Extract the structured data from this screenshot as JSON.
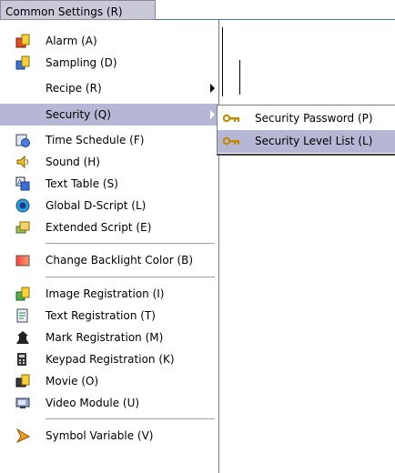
{
  "menubar": {
    "label": "Common Settings (R)"
  },
  "main_items": [
    {
      "label": "Alarm (A)",
      "icon": "alarm-icon"
    },
    {
      "label": "Sampling (D)",
      "icon": "sampling-icon"
    },
    {
      "label": "Recipe (R)",
      "icon": "",
      "submenu": true
    },
    {
      "label": "Security (Q)",
      "icon": "",
      "submenu": true,
      "selected": true
    },
    {
      "label": "Time Schedule (F)",
      "icon": "time-schedule-icon"
    },
    {
      "label": "Sound (H)",
      "icon": "sound-icon"
    },
    {
      "label": "Text Table (S)",
      "icon": "text-table-icon"
    },
    {
      "label": "Global D-Script (L)",
      "icon": "global-d-script-icon"
    },
    {
      "label": "Extended Script (E)",
      "icon": "extended-script-icon"
    },
    {
      "label": "Change Backlight Color (B)",
      "icon": "backlight-color-icon"
    },
    {
      "label": "Image Registration (I)",
      "icon": "image-registration-icon"
    },
    {
      "label": "Text Registration (T)",
      "icon": "text-registration-icon"
    },
    {
      "label": "Mark Registration (M)",
      "icon": "mark-registration-icon"
    },
    {
      "label": "Keypad Registration (K)",
      "icon": "keypad-registration-icon"
    },
    {
      "label": "Movie (O)",
      "icon": "movie-icon"
    },
    {
      "label": "Video Module (U)",
      "icon": "video-module-icon"
    },
    {
      "label": "Symbol Variable (V)",
      "icon": "symbol-variable-icon"
    }
  ],
  "security_submenu": [
    {
      "label": "Security Password (P)",
      "icon": "key-icon"
    },
    {
      "label": "Security Level List (L)",
      "icon": "key-icon",
      "selected": true
    }
  ]
}
